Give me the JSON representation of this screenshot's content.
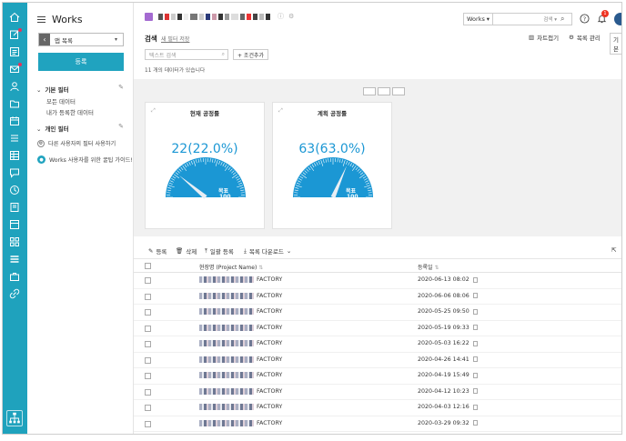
{
  "app": {
    "name": "Works"
  },
  "sidebar": {
    "app_select": "앱 목록",
    "register_button": "등록",
    "basic_filter": "기본 필터",
    "basic_items": [
      "모든 데이터",
      "내가 등록한 데이터"
    ],
    "personal_filter": "개인 필터",
    "help_items": [
      "다른 사용자의 필터 사용하기",
      "Works 사용자를 위한 꿀팁 가이드!"
    ]
  },
  "topbar": {
    "scope_select": "Works",
    "search_placeholder": "검색",
    "notification_count": "1"
  },
  "header": {
    "title": "검색",
    "save_filter": "새 필터 저장",
    "chart_fold": "차트접기",
    "list_manage": "목록 관리",
    "basic": "기본"
  },
  "filterbar": {
    "text_search_placeholder": "텍스트 검색",
    "add_condition": "+ 조건추가",
    "count_text": "11 개의 데이터가 있습니다"
  },
  "gauges": [
    {
      "title": "현재 공정률",
      "value_text": "22(22.0%)",
      "value": 22,
      "max": 100,
      "target_label": "목표",
      "target_value": "100"
    },
    {
      "title": "계획 공정률",
      "value_text": "63(63.0%)",
      "value": 63,
      "max": 100,
      "target_label": "목표",
      "target_value": "100"
    }
  ],
  "actions": {
    "register": "등록",
    "delete": "삭제",
    "bulk_register": "일괄 등록",
    "list_download": "목록 다운로드"
  },
  "table": {
    "columns": [
      "현장명 (Project Name)",
      "등록일"
    ],
    "rows": [
      {
        "name": "FACTORY",
        "date": "2020-06-13 08:02"
      },
      {
        "name": "FACTORY",
        "date": "2020-06-06 08:06"
      },
      {
        "name": "FACTORY",
        "date": "2020-05-25 09:50"
      },
      {
        "name": "FACTORY",
        "date": "2020-05-19 09:33"
      },
      {
        "name": "FACTORY",
        "date": "2020-05-03 16:22"
      },
      {
        "name": "FACTORY",
        "date": "2020-04-26 14:41"
      },
      {
        "name": "FACTORY",
        "date": "2020-04-19 15:49"
      },
      {
        "name": "FACTORY",
        "date": "2020-04-12 10:23"
      },
      {
        "name": "FACTORY",
        "date": "2020-04-03 12:16"
      },
      {
        "name": "FACTORY",
        "date": "2020-03-29 09:32"
      }
    ]
  },
  "colors": {
    "rail": "#1fa2bd",
    "accent": "#20a3bf",
    "gauge": "#1b97d4"
  }
}
